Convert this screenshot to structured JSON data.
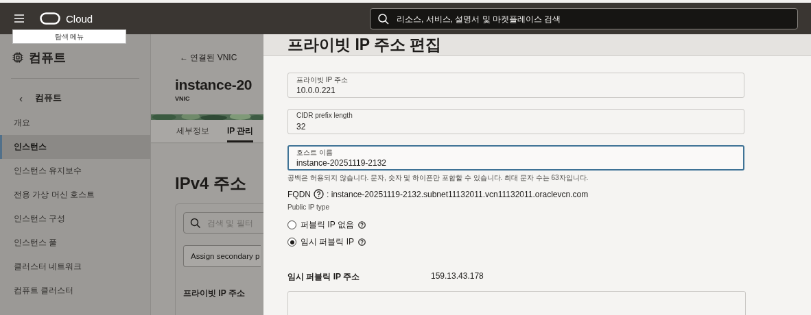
{
  "topbar": {
    "brand": "Cloud",
    "menu_tooltip": "탐색 메뉴",
    "search_placeholder": "리소스, 서비스, 설명서 및 마켓플레이스 검색"
  },
  "sidebar": {
    "title": "컴퓨트",
    "back_icon": "‹",
    "back": "컴퓨트",
    "items": [
      {
        "label": "개요",
        "selected": false
      },
      {
        "label": "인스턴스",
        "selected": true
      },
      {
        "label": "인스턴스 유지보수",
        "selected": false
      },
      {
        "label": "전용 가상 머신 호스트",
        "selected": false
      },
      {
        "label": "인스턴스 구성",
        "selected": false
      },
      {
        "label": "인스턴스 풀",
        "selected": false
      },
      {
        "label": "클러스터 네트워크",
        "selected": false
      },
      {
        "label": "컴퓨트 클러스터",
        "selected": false
      }
    ]
  },
  "main": {
    "back_arrow": "←",
    "back_link": "연결된 VNIC",
    "title": "instance-20",
    "subtitle": "VNIC",
    "tabs": [
      {
        "label": "세부정보",
        "selected": false
      },
      {
        "label": "IP 관리",
        "selected": true
      }
    ],
    "section_title": "IPv4 주소",
    "search_placeholder": "검색 및 필터",
    "assign_button": "Assign secondary p",
    "table": {
      "columns": [
        "프라이빗 IP 주소"
      ]
    }
  },
  "panel": {
    "title": "프라이빗 IP 주소 편집",
    "fields": [
      {
        "label": "프라이빗 IP 주소",
        "value": "10.0.0.221",
        "focused": false
      },
      {
        "label": "CIDR prefix length",
        "value": "32",
        "focused": false
      },
      {
        "label": "호스트 이름",
        "value": "instance-20251119-2132",
        "focused": true
      }
    ],
    "help": "공백은 허용되지 않습니다. 문자, 숫자 및 하이픈만 포함할 수 있습니다. 최대 문자 수는 63자입니다.",
    "fqdn_label": "FQDN",
    "fqdn_value": ": instance-20251119-2132.subnet11132011.vcn11132011.oraclevcn.com",
    "public_ip_type_label": "Public IP type",
    "radios": [
      {
        "label": "퍼블릭 IP 없음",
        "selected": false
      },
      {
        "label": "임시 퍼블릭 IP",
        "selected": true
      }
    ],
    "ephemeral": {
      "label": "임시 퍼블릭 IP 주소",
      "value": "159.13.43.178"
    }
  }
}
